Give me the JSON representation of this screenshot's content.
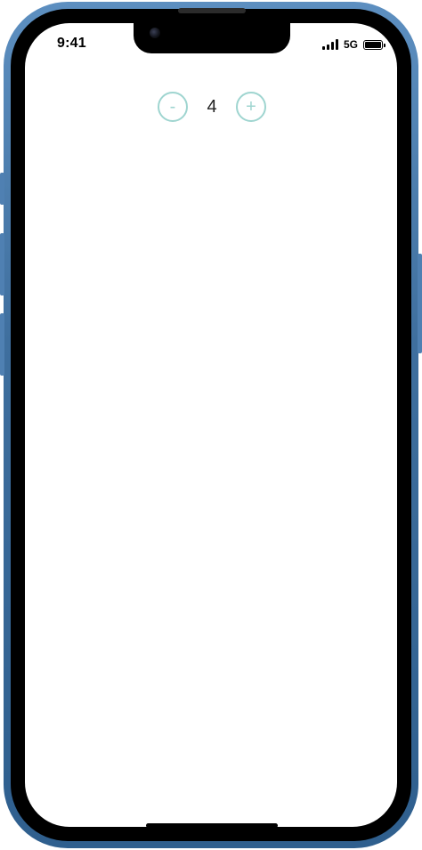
{
  "status_bar": {
    "time": "9:41",
    "network": "5G",
    "battery_level": 1.0
  },
  "icons": {
    "signal": "signal-bars-icon",
    "battery": "battery-icon",
    "camera": "front-camera-icon"
  },
  "stepper": {
    "decrement_label": "-",
    "value": "4",
    "increment_label": "+",
    "accent_color": "#9fd5d0"
  },
  "colors": {
    "frame": "#3f6f9e",
    "bezel": "#000000",
    "screen": "#ffffff"
  }
}
